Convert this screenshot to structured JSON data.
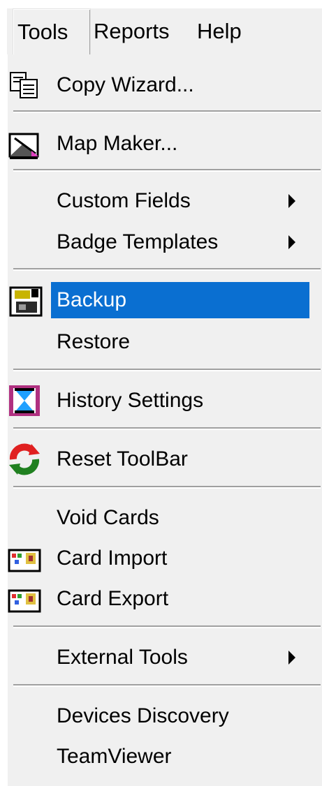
{
  "menubar": {
    "tools": "Tools",
    "reports": "Reports",
    "help": "Help"
  },
  "menu": {
    "copy_wizard": "Copy Wizard...",
    "map_maker": "Map Maker...",
    "custom_fields": "Custom Fields",
    "badge_templates": "Badge Templates",
    "backup": "Backup",
    "restore": "Restore",
    "history_settings": "History Settings",
    "reset_toolbar": "Reset ToolBar",
    "void_cards": "Void Cards",
    "card_import": "Card Import",
    "card_export": "Card Export",
    "external_tools": "External Tools",
    "devices_discovery": "Devices Discovery",
    "teamviewer": "TeamViewer"
  },
  "colors": {
    "highlight": "#0a6fd1",
    "menu_bg": "#f0f0f0"
  },
  "icons": {
    "copy_wizard": "copy-wizard-icon",
    "map_maker": "map-maker-icon",
    "backup": "backup-icon",
    "history_settings": "history-settings-icon",
    "reset_toolbar": "reset-toolbar-icon",
    "card_import": "card-import-icon",
    "card_export": "card-export-icon"
  }
}
